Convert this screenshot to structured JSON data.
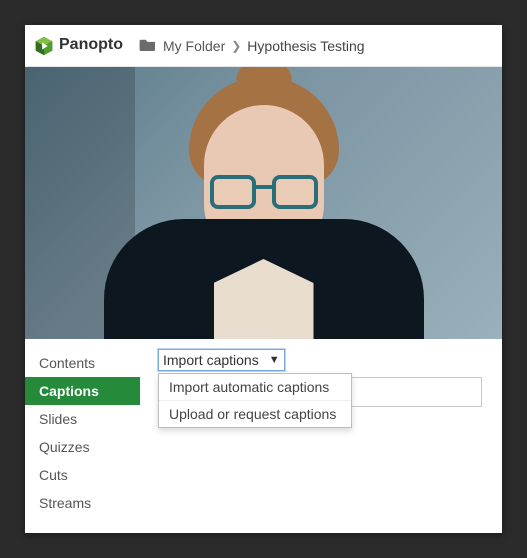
{
  "brand": {
    "name": "Panopto"
  },
  "breadcrumb": {
    "folder_label": "My Folder",
    "current_title": "Hypothesis Testing"
  },
  "sidebar": {
    "items": [
      {
        "label": "Contents",
        "active": false
      },
      {
        "label": "Captions",
        "active": true
      },
      {
        "label": "Slides",
        "active": false
      },
      {
        "label": "Quizzes",
        "active": false
      },
      {
        "label": "Cuts",
        "active": false
      },
      {
        "label": "Streams",
        "active": false
      }
    ]
  },
  "captions": {
    "import_button_label": "Import captions",
    "menu": {
      "items": [
        {
          "label": "Import automatic captions"
        },
        {
          "label": "Upload or request captions"
        }
      ]
    }
  }
}
